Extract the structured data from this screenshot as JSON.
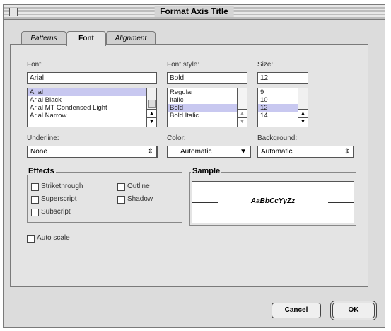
{
  "window": {
    "title": "Format Axis Title"
  },
  "tabs": [
    {
      "label": "Patterns"
    },
    {
      "label": "Font"
    },
    {
      "label": "Alignment"
    }
  ],
  "font": {
    "label": "Font:",
    "value": "Arial",
    "items": [
      "Arial",
      "Arial Black",
      "Arial MT Condensed Light",
      "Arial Narrow"
    ]
  },
  "font_style": {
    "label": "Font style:",
    "value": "Bold",
    "items": [
      "Regular",
      "Italic",
      "Bold",
      "Bold Italic"
    ]
  },
  "size": {
    "label": "Size:",
    "value": "12",
    "items": [
      "9",
      "10",
      "12",
      "14"
    ]
  },
  "underline": {
    "label": "Underline:",
    "value": "None"
  },
  "color": {
    "label": "Color:",
    "value": "Automatic"
  },
  "background": {
    "label": "Background:",
    "value": "Automatic"
  },
  "effects": {
    "title": "Effects",
    "strikethrough": "Strikethrough",
    "superscript": "Superscript",
    "subscript": "Subscript",
    "outline": "Outline",
    "shadow": "Shadow"
  },
  "sample": {
    "title": "Sample",
    "text": "AaBbCcYyZz"
  },
  "auto_scale": {
    "label": "Auto scale"
  },
  "buttons": {
    "cancel": "Cancel",
    "ok": "OK"
  },
  "colors": {
    "selection": "#c8c8f0",
    "dialog_bg": "#dcdcdc"
  }
}
